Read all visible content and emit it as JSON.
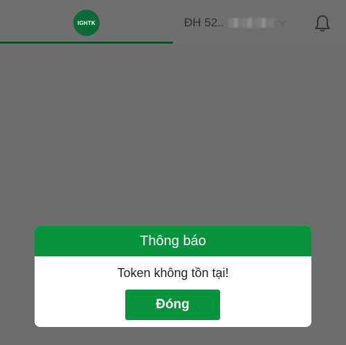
{
  "header": {
    "logo_text": "IGHTK",
    "order_label": "ĐH 52..",
    "icons": {
      "dropdown": "chevron-down-icon",
      "notification": "bell-icon"
    }
  },
  "dialog": {
    "title": "Thông báo",
    "message": "Token không tồn tại!",
    "button_label": "Đóng"
  },
  "colors": {
    "overlay_gray": "#6d6d6d",
    "brand_green": "#07933c",
    "logo_green": "#0b6a35",
    "tab_underline": "#0d4a2a"
  }
}
